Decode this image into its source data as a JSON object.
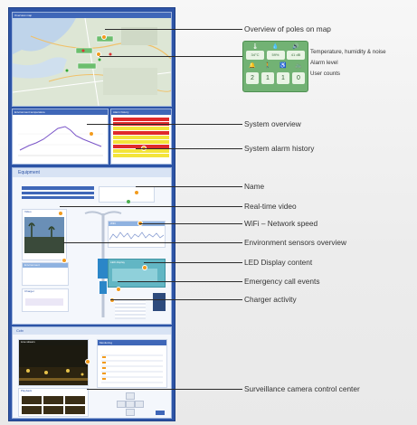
{
  "labels": {
    "overview_map": "Overview of poles on map",
    "system_overview": "System overview",
    "alarm_history": "System alarm history",
    "name": "Name",
    "realtime_video": "Real-time video",
    "wifi": "WiFi – Network speed",
    "env_sensors": "Environment sensors overview",
    "led_display": "LED Display content",
    "emergency": "Emergency call events",
    "charger": "Charger activity",
    "surveillance": "Surveillance camera  control center"
  },
  "sensor_card": {
    "temperature": "34°C",
    "humidity": "59%",
    "noise": "41 dB",
    "count_1": "2",
    "count_2": "1",
    "count_3": "1",
    "count_4": "0",
    "notes": [
      "Temperature, humidity & noise",
      "Alarm level",
      "User counts"
    ]
  },
  "panel_titles": {
    "map": "Overview map",
    "chart": "Environment temperature",
    "alarm": "Alarm history",
    "equipment": "Equipment",
    "camera_live": "Live camera",
    "wifi_panel": "WiFi",
    "env_panel": "Environment",
    "led_panel": "LED display",
    "charger_panel": "Charger",
    "video_panel": "Video",
    "cctv": "Cctv",
    "live_stream": "Live stream",
    "monitor": "Monitoring",
    "playback": "Playback"
  },
  "colors": {
    "panel_blue": "#2d54a6",
    "accent_orange": "#f29b1d",
    "alarm_red": "#e02a2a",
    "alarm_yellow": "#f3e43a",
    "sensor_green": "#72b274"
  },
  "icons": [
    "thermometer-icon",
    "water-drop-icon",
    "speaker-icon",
    "bell-icon",
    "person-icon",
    "wheelchair-icon",
    "bicycle-icon"
  ]
}
